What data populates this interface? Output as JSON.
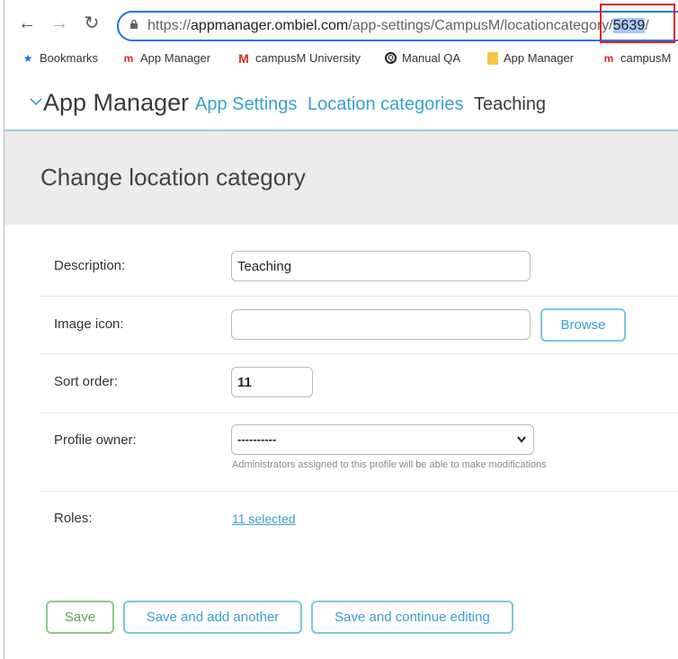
{
  "browser": {
    "url_prefix": "https://",
    "url_host": "appmanager.ombiel.com",
    "url_path": "/app-settings/CampusM/locationcategory/",
    "url_selected": "5639",
    "url_suffix": "/"
  },
  "bookmarks": [
    {
      "label": "Bookmarks",
      "icon": "star-icon"
    },
    {
      "label": "App Manager",
      "icon": "m-logo-icon"
    },
    {
      "label": "campusM University",
      "icon": "m-logo-icon"
    },
    {
      "label": "Manual QA",
      "icon": "qa-icon"
    },
    {
      "label": "App Manager",
      "icon": "folder-icon"
    },
    {
      "label": "campusM",
      "icon": "m-logo-icon"
    }
  ],
  "header": {
    "brand": "App Manager",
    "breadcrumbs": [
      "App Settings",
      "Location categories",
      "Teaching"
    ]
  },
  "page": {
    "title": "Change location category"
  },
  "form": {
    "description_label": "Description:",
    "description_value": "Teaching",
    "image_icon_label": "Image icon:",
    "image_icon_value": "",
    "browse_label": "Browse",
    "sort_order_label": "Sort order:",
    "sort_order_value": "11",
    "profile_owner_label": "Profile owner:",
    "profile_owner_value": "----------",
    "profile_owner_hint": "Administrators assigned to this profile will be able to make modifications",
    "roles_label": "Roles:",
    "roles_value": "11 selected"
  },
  "actions": {
    "save": "Save",
    "save_add": "Save and add another",
    "save_continue": "Save and continue editing"
  },
  "colors": {
    "accent": "#3aa0cc",
    "save_green": "#5aa55a",
    "highlight_red": "#e02020"
  }
}
